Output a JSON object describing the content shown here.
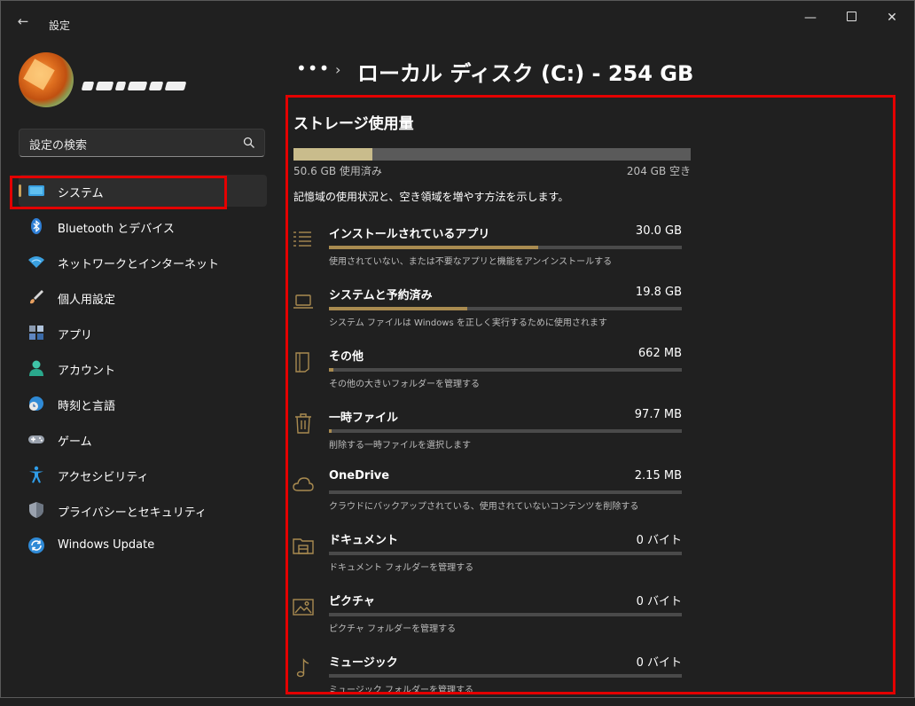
{
  "window": {
    "title": "設定",
    "back_glyph": "←",
    "minimize_glyph": "—",
    "close_glyph": "✕"
  },
  "search": {
    "placeholder": "設定の検索"
  },
  "nav": [
    {
      "label": "システム",
      "icon": "monitor-icon",
      "active": true
    },
    {
      "label": "Bluetooth とデバイス",
      "icon": "bluetooth-icon"
    },
    {
      "label": "ネットワークとインターネット",
      "icon": "wifi-icon"
    },
    {
      "label": "個人用設定",
      "icon": "brush-icon"
    },
    {
      "label": "アプリ",
      "icon": "apps-icon"
    },
    {
      "label": "アカウント",
      "icon": "person-icon"
    },
    {
      "label": "時刻と言語",
      "icon": "globe-clock-icon"
    },
    {
      "label": "ゲーム",
      "icon": "gamepad-icon"
    },
    {
      "label": "アクセシビリティ",
      "icon": "accessibility-icon"
    },
    {
      "label": "プライバシーとセキュリティ",
      "icon": "shield-icon"
    },
    {
      "label": "Windows Update",
      "icon": "update-icon"
    }
  ],
  "breadcrumb": {
    "more": "•••",
    "separator": "›",
    "title": "ローカル ディスク (C:) - 254 GB"
  },
  "storage": {
    "heading": "ストレージ使用量",
    "used_label": "50.6 GB 使用済み",
    "free_label": "204 GB 空き",
    "used_fraction": 0.199,
    "description": "記憶域の使用状況と、空き領域を増やす方法を示します。",
    "categories": [
      {
        "name": "インストールされているアプリ",
        "size": "30.0 GB",
        "fraction": 0.593,
        "sub": "使用されていない、または不要なアプリと機能をアンインストールする",
        "icon": "apps-list-icon"
      },
      {
        "name": "システムと予約済み",
        "size": "19.8 GB",
        "fraction": 0.391,
        "sub": "システム ファイルは Windows を正しく実行するために使用されます",
        "icon": "laptop-icon"
      },
      {
        "name": "その他",
        "size": "662 MB",
        "fraction": 0.013,
        "sub": "その他の大きいフォルダーを管理する",
        "icon": "folder-other-icon"
      },
      {
        "name": "一時ファイル",
        "size": "97.7 MB",
        "fraction": 0.002,
        "sub": "削除する一時ファイルを選択します",
        "icon": "trash-icon"
      },
      {
        "name": "OneDrive",
        "size": "2.15 MB",
        "fraction": 0.0,
        "sub": "クラウドにバックアップされている、使用されていないコンテンツを削除する",
        "icon": "cloud-icon"
      },
      {
        "name": "ドキュメント",
        "size": "0 バイト",
        "fraction": 0.0,
        "sub": "ドキュメント フォルダーを管理する",
        "icon": "documents-folder-icon"
      },
      {
        "name": "ピクチャ",
        "size": "0 バイト",
        "fraction": 0.0,
        "sub": "ピクチャ フォルダーを管理する",
        "icon": "picture-icon"
      },
      {
        "name": "ミュージック",
        "size": "0 バイト",
        "fraction": 0.0,
        "sub": "ミュージック フォルダーを管理する",
        "icon": "music-note-icon"
      }
    ]
  },
  "colors": {
    "accent": "#c9a15a",
    "highlight_frame": "#e30000",
    "bar_fill": "#c9bc8c",
    "category_fill": "#a98b50"
  }
}
